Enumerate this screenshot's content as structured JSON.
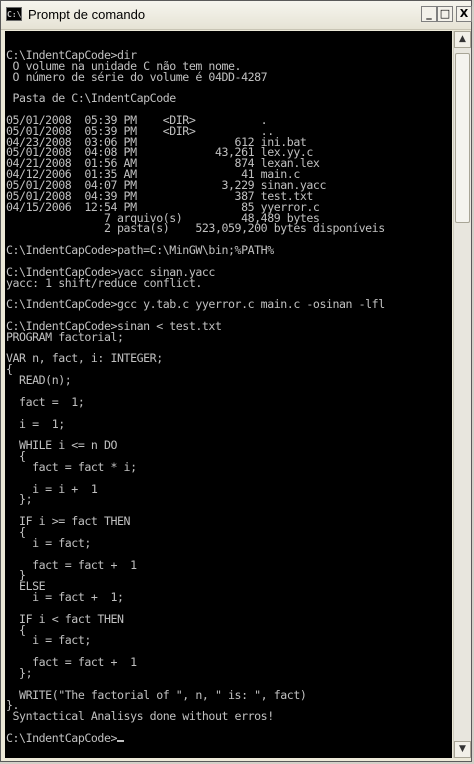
{
  "window": {
    "title": "Prompt de comando",
    "icon": "cmd-icon",
    "icon_text": "C:\\",
    "controls": {
      "minimize": "_",
      "maximize": "□",
      "close": "X"
    }
  },
  "console": {
    "lines": [
      "",
      "C:\\IndentCapCode>dir",
      " O volume na unidade C não tem nome.",
      " O número de série do volume é 04DD-4287",
      "",
      " Pasta de C:\\IndentCapCode",
      "",
      "05/01/2008  05:39 PM    <DIR>          .",
      "05/01/2008  05:39 PM    <DIR>          ..",
      "04/23/2008  03:06 PM               612 ini.bat",
      "05/01/2008  04:08 PM            43,261 lex.yy.c",
      "04/21/2008  01:56 AM               874 lexan.lex",
      "04/12/2006  01:35 AM                41 main.c",
      "05/01/2008  04:07 PM             3,229 sinan.yacc",
      "05/01/2008  04:39 PM               387 test.txt",
      "04/15/2006  12:54 PM                85 yyerror.c",
      "               7 arquivo(s)         48,489 bytes",
      "               2 pasta(s)    523,059,200 bytes disponíveis",
      "",
      "C:\\IndentCapCode>path=C:\\MinGW\\bin;%PATH%",
      "",
      "C:\\IndentCapCode>yacc sinan.yacc",
      "yacc: 1 shift/reduce conflict.",
      "",
      "C:\\IndentCapCode>gcc y.tab.c yyerror.c main.c -osinan -lfl",
      "",
      "C:\\IndentCapCode>sinan < test.txt",
      "PROGRAM factorial;",
      "",
      "VAR n, fact, i: INTEGER;",
      "{",
      "  READ(n);",
      "",
      "  fact =  1;",
      "",
      "  i =  1;",
      "",
      "  WHILE i <= n DO",
      "  {",
      "    fact = fact * i;",
      "",
      "    i = i +  1",
      "  };",
      "",
      "  IF i >= fact THEN",
      "  {",
      "    i = fact;",
      "",
      "    fact = fact +  1",
      "  }",
      "  ELSE",
      "    i = fact +  1;",
      "",
      "  IF i < fact THEN",
      "  {",
      "    i = fact;",
      "",
      "    fact = fact +  1",
      "  };",
      "",
      "  WRITE(\"The factorial of \", n, \" is: \", fact)",
      "}.",
      " Syntactical Analisys done without erros!",
      "",
      "C:\\IndentCapCode>"
    ]
  },
  "scrollbar": {
    "up_arrow": "▲",
    "down_arrow": "▼"
  },
  "colors": {
    "console_bg": "#000000",
    "console_text": "#c0c0c0"
  }
}
